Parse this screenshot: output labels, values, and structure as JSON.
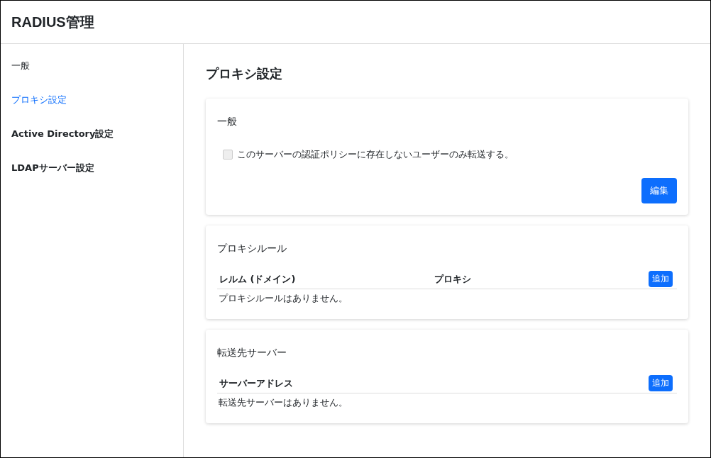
{
  "header": {
    "title": "RADIUS管理"
  },
  "sidebar": {
    "items": [
      {
        "label": "一般",
        "selected": false
      },
      {
        "label": "プロキシ設定",
        "selected": true
      },
      {
        "label": "Active Directory設定",
        "selected": false
      },
      {
        "label": "LDAPサーバー設定",
        "selected": false
      }
    ]
  },
  "page_title": "プロキシ設定",
  "general_card": {
    "title": "一般",
    "checkbox": {
      "label": "このサーバーの認証ポリシーに存在しないユーザーのみ転送する。",
      "checked": false,
      "disabled": true
    },
    "button": "編集"
  },
  "tables": [
    {
      "title": "プロキシルール",
      "columns": [
        "レルム (ドメイン)",
        "プロキシ"
      ],
      "add_button": "追加",
      "empty_text": "プロキシルールはありません。"
    },
    {
      "title": "転送先サーバー",
      "columns": [
        "サーバーアドレス"
      ],
      "add_button": "追加",
      "empty_text": "転送先サーバーはありません。"
    }
  ]
}
